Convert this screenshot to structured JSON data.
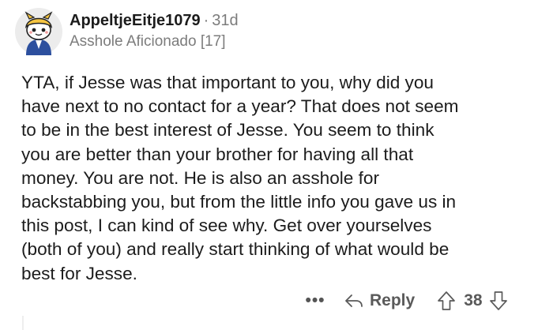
{
  "comment": {
    "username": "AppeltjeEitje1079",
    "separator": "·",
    "age": "31d",
    "flair": "Asshole Aficionado [17]",
    "body_lines": [
      "YTA, if Jesse was that important to you, why did you",
      "have next to no contact for a year? That does not seem",
      "to be in the best interest of Jesse. You seem to think",
      "you are better than your brother for having all that",
      "money. You are not. He is also an asshole for",
      "backstabbing you, but from the little info you gave us in",
      "this post, I can kind of see why. Get over yourselves",
      "(both of you) and really start thinking of what would be",
      "best for Jesse."
    ]
  },
  "actions": {
    "more_label": "•••",
    "reply_label": "Reply",
    "score": "38"
  },
  "icons": {
    "avatar": "snoo-avatar-icon",
    "reply": "reply-arrow-icon",
    "upvote": "upvote-arrow-icon",
    "downvote": "downvote-arrow-icon"
  },
  "colors": {
    "text": "#1c1c1c",
    "meta": "#7c7c7c",
    "action": "#5a5a5a",
    "avatar_yellow": "#f5c542",
    "avatar_blue": "#2c4f9e"
  }
}
